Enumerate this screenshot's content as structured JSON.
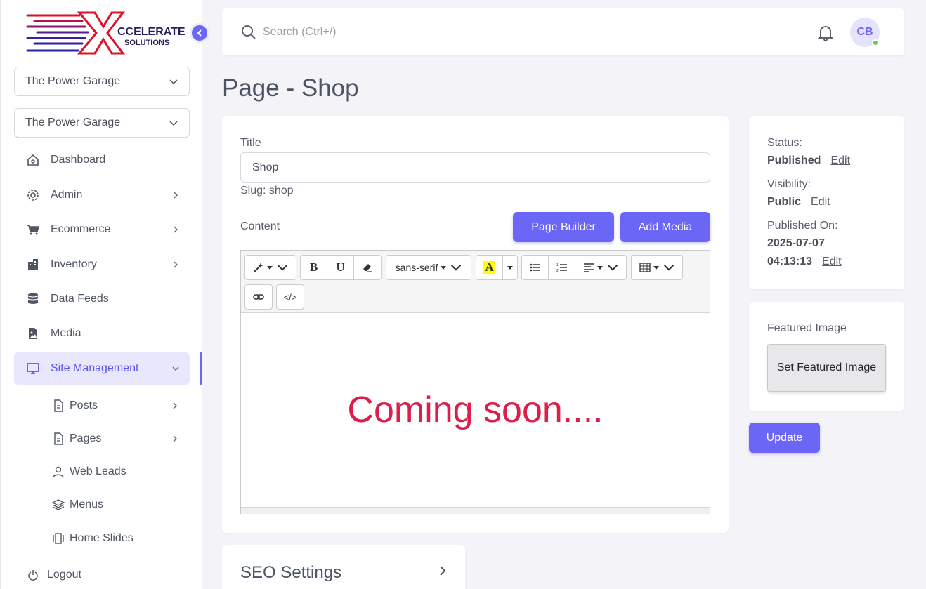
{
  "brand": {
    "logo_text": "CCELERATE",
    "logo_sub": "SOLUTIONS"
  },
  "sidebar": {
    "store_selects": [
      "The Power Garage",
      "The Power Garage"
    ],
    "items": [
      {
        "label": "Dashboard",
        "icon": "home-icon"
      },
      {
        "label": "Admin",
        "icon": "gear-icon"
      },
      {
        "label": "Ecommerce",
        "icon": "cart-icon"
      },
      {
        "label": "Inventory",
        "icon": "building-icon"
      },
      {
        "label": "Data Feeds",
        "icon": "database-icon"
      },
      {
        "label": "Media",
        "icon": "image-icon"
      },
      {
        "label": "Site Management",
        "icon": "monitor-icon"
      }
    ],
    "sub_items": [
      {
        "label": "Posts",
        "icon": "document-icon"
      },
      {
        "label": "Pages",
        "icon": "document-icon"
      },
      {
        "label": "Web Leads",
        "icon": "user-icon"
      },
      {
        "label": "Menus",
        "icon": "layers-icon"
      },
      {
        "label": "Home Slides",
        "icon": "slides-icon"
      }
    ],
    "logout": "Logout"
  },
  "topbar": {
    "search_placeholder": "Search (Ctrl+/)",
    "avatar_initials": "CB"
  },
  "page": {
    "title": "Page - Shop"
  },
  "form": {
    "title_label": "Title",
    "title_value": "Shop",
    "slug": "Slug: shop",
    "content_label": "Content",
    "page_builder": "Page Builder",
    "add_media": "Add Media"
  },
  "editor": {
    "font_name": "sans-serif",
    "content": "Coming soon....",
    "content_color": "#dc1e4a",
    "bold": "B",
    "underline": "U",
    "highlight": "A",
    "code": "</>"
  },
  "status": {
    "status_label": "Status:",
    "status_value": "Published",
    "visibility_label": "Visibility:",
    "visibility_value": "Public",
    "published_label": "Published On:",
    "published_date": "2025-07-07",
    "published_time": "04:13:13",
    "edit": "Edit"
  },
  "featured": {
    "label": "Featured Image",
    "button": "Set Featured Image"
  },
  "update_button": "Update",
  "seo": {
    "title": "SEO Settings"
  },
  "colors": {
    "accent": "#6b66f6",
    "active_bg": "#e9e7fb",
    "logo_red": "#e0102a",
    "logo_blue": "#3b1fa8"
  }
}
